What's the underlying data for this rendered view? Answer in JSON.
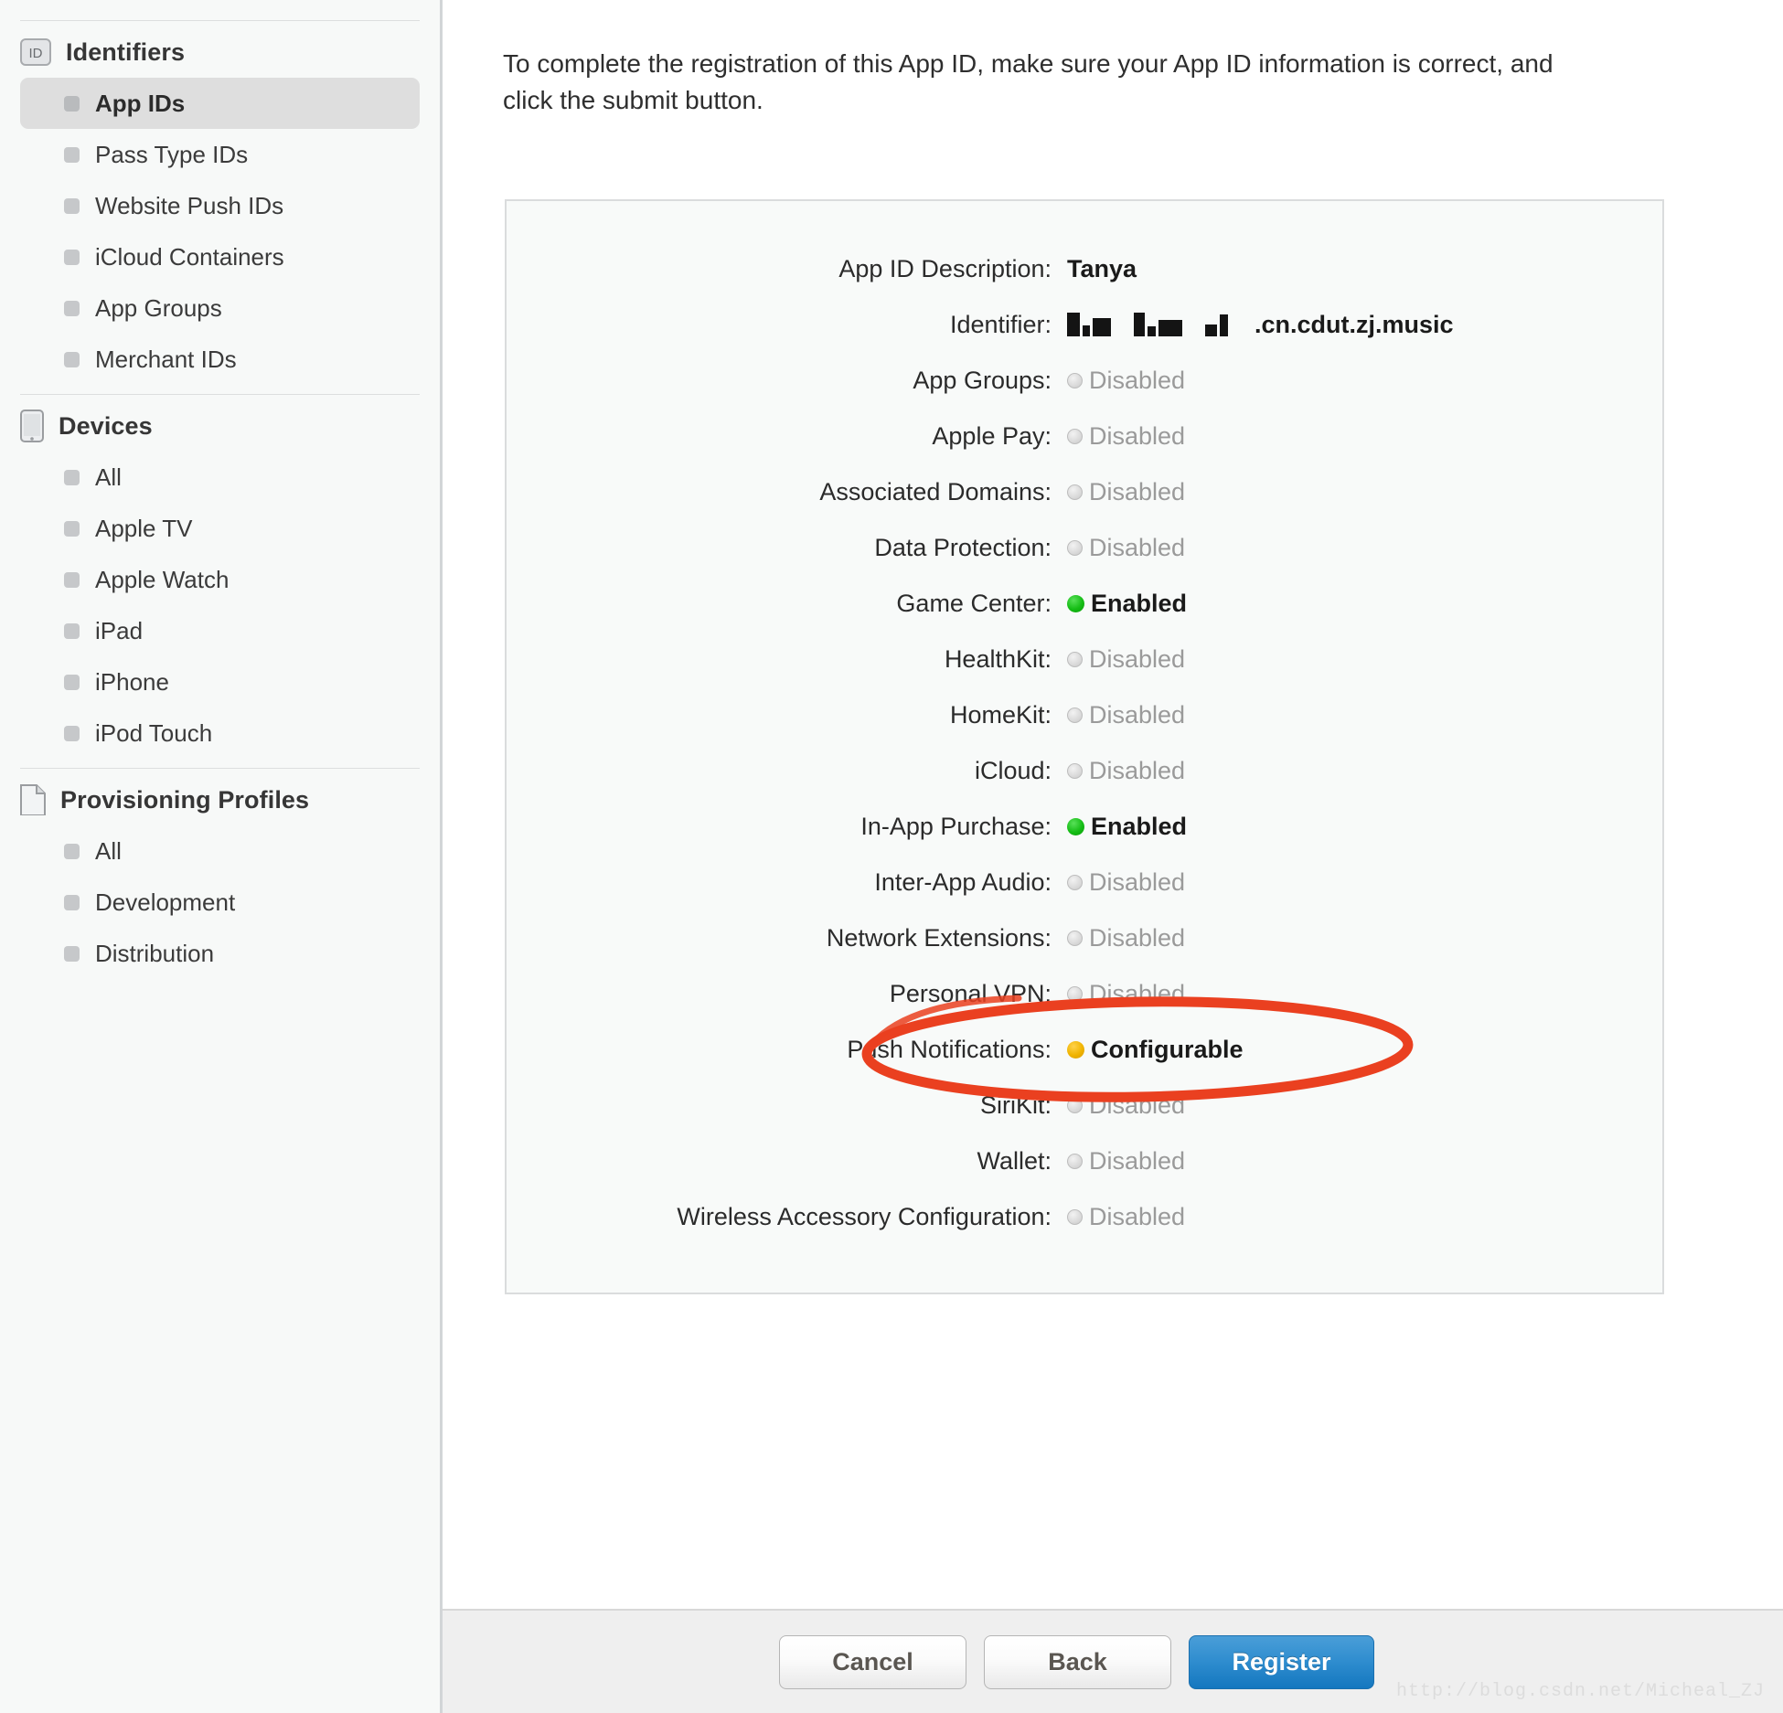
{
  "sidebar": {
    "groups": [
      {
        "title": "Identifiers",
        "icon": "id-badge-icon",
        "items": [
          {
            "label": "App IDs",
            "selected": true
          },
          {
            "label": "Pass Type IDs",
            "selected": false
          },
          {
            "label": "Website Push IDs",
            "selected": false
          },
          {
            "label": "iCloud Containers",
            "selected": false
          },
          {
            "label": "App Groups",
            "selected": false
          },
          {
            "label": "Merchant IDs",
            "selected": false
          }
        ]
      },
      {
        "title": "Devices",
        "icon": "device-icon",
        "items": [
          {
            "label": "All",
            "selected": false
          },
          {
            "label": "Apple TV",
            "selected": false
          },
          {
            "label": "Apple Watch",
            "selected": false
          },
          {
            "label": "iPad",
            "selected": false
          },
          {
            "label": "iPhone",
            "selected": false
          },
          {
            "label": "iPod Touch",
            "selected": false
          }
        ]
      },
      {
        "title": "Provisioning Profiles",
        "icon": "document-icon",
        "items": [
          {
            "label": "All",
            "selected": false
          },
          {
            "label": "Development",
            "selected": false
          },
          {
            "label": "Distribution",
            "selected": false
          }
        ]
      }
    ]
  },
  "main": {
    "intro": "To complete the registration of this App ID, make sure your App ID information is correct, and click the submit button.",
    "rows": [
      {
        "label": "App ID Description:",
        "value": "Tanya",
        "state": "plain"
      },
      {
        "label": "Identifier:",
        "value": ".cn.cdut.zj.music",
        "state": "redacted-prefix"
      },
      {
        "label": "App Groups:",
        "value": "Disabled",
        "state": "off"
      },
      {
        "label": "Apple Pay:",
        "value": "Disabled",
        "state": "off"
      },
      {
        "label": "Associated Domains:",
        "value": "Disabled",
        "state": "off"
      },
      {
        "label": "Data Protection:",
        "value": "Disabled",
        "state": "off"
      },
      {
        "label": "Game Center:",
        "value": "Enabled",
        "state": "on"
      },
      {
        "label": "HealthKit:",
        "value": "Disabled",
        "state": "off"
      },
      {
        "label": "HomeKit:",
        "value": "Disabled",
        "state": "off"
      },
      {
        "label": "iCloud:",
        "value": "Disabled",
        "state": "off"
      },
      {
        "label": "In-App Purchase:",
        "value": "Enabled",
        "state": "on"
      },
      {
        "label": "Inter-App Audio:",
        "value": "Disabled",
        "state": "off"
      },
      {
        "label": "Network Extensions:",
        "value": "Disabled",
        "state": "off"
      },
      {
        "label": "Personal VPN:",
        "value": "Disabled",
        "state": "off"
      },
      {
        "label": "Push Notifications:",
        "value": "Configurable",
        "state": "cfg",
        "highlighted": true
      },
      {
        "label": "SiriKit:",
        "value": "Disabled",
        "state": "off"
      },
      {
        "label": "Wallet:",
        "value": "Disabled",
        "state": "off"
      },
      {
        "label": "Wireless Accessory Configuration:",
        "value": "Disabled",
        "state": "off"
      }
    ]
  },
  "footer": {
    "cancel_label": "Cancel",
    "back_label": "Back",
    "register_label": "Register",
    "watermark": "http://blog.csdn.net/Micheal_ZJ"
  },
  "colors": {
    "enabled_dot": "#15bd15",
    "configurable_dot": "#f0b400",
    "disabled_dot": "#d2d2d2",
    "annotation": "#ea4020",
    "register_button": "#2f8dcf",
    "sidebar_bg": "#f7f9f8"
  }
}
